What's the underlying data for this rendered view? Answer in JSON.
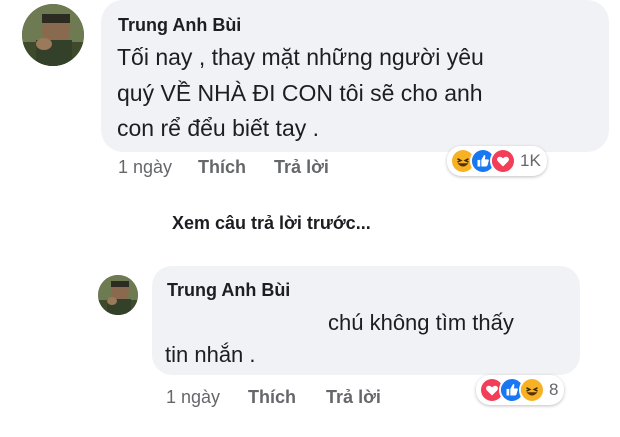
{
  "comment": {
    "author": "Trung Anh Bùi",
    "text_lines": [
      "Tối nay , thay mặt những người yêu",
      "quý VỀ NHÀ ĐI CON tôi sẽ cho anh",
      "con rể đểu biết tay ."
    ],
    "time": "1 ngày",
    "like_label": "Thích",
    "reply_label": "Trả lời",
    "reaction_count": "1K",
    "reactions": [
      "haha-icon",
      "like-icon",
      "love-icon"
    ]
  },
  "view_previous_label": "Xem câu trả lời trước...",
  "reply": {
    "author": "Trung Anh Bùi",
    "text_line1": "chú không tìm thấy",
    "text_line2": "tin nhắn .",
    "time": "1 ngày",
    "like_label": "Thích",
    "reply_label": "Trả lời",
    "reaction_count": "8",
    "reactions": [
      "love-icon",
      "like-icon",
      "haha-icon"
    ]
  },
  "colors": {
    "bubble": "#f0f2f5",
    "like_blue": "#1877f2",
    "love_red": "#f33e58",
    "haha_yellow": "#f7b125"
  }
}
